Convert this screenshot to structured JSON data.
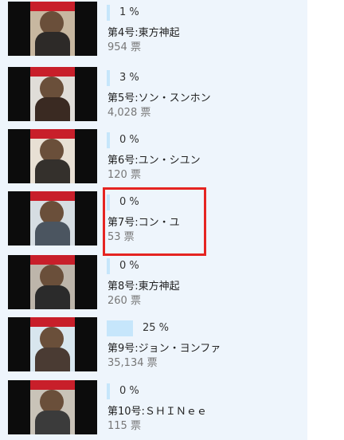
{
  "entries": [
    {
      "percent": "1 %",
      "fraction": 0.01,
      "title": "第4号:東方神起",
      "votes": "954 票",
      "cover_colors": [
        "#2d2a28",
        "#c7b7a0"
      ]
    },
    {
      "percent": "3 %",
      "fraction": 0.03,
      "title": "第5号:ソン・スンホン",
      "votes": "4,028 票",
      "cover_colors": [
        "#3a2a22",
        "#e0ddd8"
      ]
    },
    {
      "percent": "0 %",
      "fraction": 0.0,
      "title": "第6号:ユン・シユン",
      "votes": "120 票",
      "cover_colors": [
        "#34302c",
        "#e8e0d4"
      ]
    },
    {
      "percent": "0 %",
      "fraction": 0.0,
      "title": "第7号:コン・ユ",
      "votes": "53 票",
      "cover_colors": [
        "#4b5560",
        "#d6dde2"
      ]
    },
    {
      "percent": "0 %",
      "fraction": 0.0,
      "title": "第8号:東方神起",
      "votes": "260 票",
      "cover_colors": [
        "#2b2b2b",
        "#bdb5aa"
      ]
    },
    {
      "percent": "25 %",
      "fraction": 0.25,
      "title": "第9号:ジョン・ヨンファ",
      "votes": "35,134 票",
      "cover_colors": [
        "#4a3b33",
        "#d8e6ee"
      ]
    },
    {
      "percent": "0 %",
      "fraction": 0.0,
      "title": "第10号:ＳＨＩＮｅｅ",
      "votes": "115 票",
      "cover_colors": [
        "#3b3b3b",
        "#c9c3b8"
      ]
    }
  ],
  "colors": {
    "panel_bg": "#eef5fc",
    "bar_fill": "#c6e6fb",
    "highlight_border": "#e52421",
    "masthead": "#c81f2a"
  }
}
